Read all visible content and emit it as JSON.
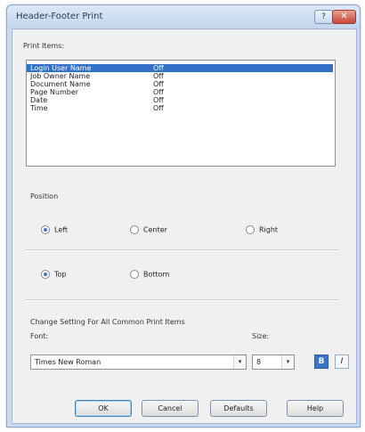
{
  "window": {
    "title": "Header-Footer Print",
    "help_glyph": "?",
    "close_glyph": "✕"
  },
  "print_items": {
    "label": "Print Items:",
    "rows": [
      {
        "name": "Login User Name",
        "value": "Off",
        "selected": true
      },
      {
        "name": "Job Owner Name",
        "value": "Off"
      },
      {
        "name": "Document Name",
        "value": "Off"
      },
      {
        "name": "Page Number",
        "value": "Off"
      },
      {
        "name": "Date",
        "value": "Off"
      },
      {
        "name": "Time",
        "value": "Off"
      }
    ]
  },
  "position": {
    "label": "Position",
    "horizontal": [
      {
        "label": "Left",
        "checked": true
      },
      {
        "label": "Center",
        "checked": false
      },
      {
        "label": "Right",
        "checked": false
      }
    ],
    "vertical": [
      {
        "label": "Top",
        "checked": true
      },
      {
        "label": "Bottom",
        "checked": false
      }
    ]
  },
  "change_setting": {
    "label": "Change Setting For All Common Print Items",
    "font_label": "Font:",
    "size_label": "Size:",
    "font_value": "Times New Roman",
    "size_value": "8",
    "dropdown_glyph": "▾",
    "bold_glyph": "B",
    "italic_glyph": "I"
  },
  "buttons": {
    "ok": "OK",
    "cancel": "Cancel",
    "defaults": "Defaults",
    "help": "Help"
  }
}
